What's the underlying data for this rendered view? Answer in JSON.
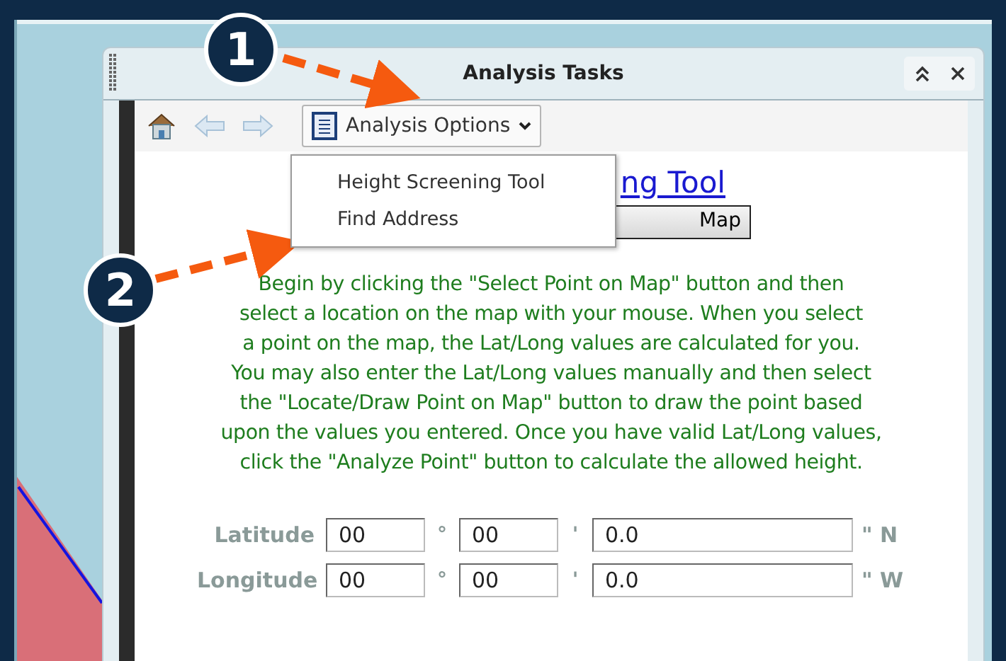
{
  "window": {
    "title": "Analysis Tasks"
  },
  "toolbar": {
    "dropdown": "Analysis Options"
  },
  "menu": {
    "items": [
      {
        "label": "Height Screening Tool"
      },
      {
        "label": "Find Address"
      }
    ]
  },
  "tool": {
    "heading": "ng Tool",
    "select_button": "Map",
    "instructions": [
      "Begin by clicking the \"Select Point on Map\" button and then",
      "select a location on the map with your mouse. When you select",
      "a point on the map, the Lat/Long values are calculated for you.",
      "You may also enter the Lat/Long values manually and then select",
      "the \"Locate/Draw Point on Map\" button to draw the point based",
      "upon the values you entered. Once you have valid Lat/Long values,",
      "click the \"Analyze Point\" button to calculate the allowed height."
    ]
  },
  "coordinates": [
    {
      "label": "Latitude",
      "degrees": "00",
      "degree_mark": "°",
      "minutes": "00",
      "minute_mark": "'",
      "seconds": "0.0",
      "suffix": "\" N"
    },
    {
      "label": "Longitude",
      "degrees": "00",
      "degree_mark": "°",
      "minutes": "00",
      "minute_mark": "'",
      "seconds": "0.0",
      "suffix": "\" W"
    }
  ],
  "callouts": [
    "1",
    "2"
  ]
}
